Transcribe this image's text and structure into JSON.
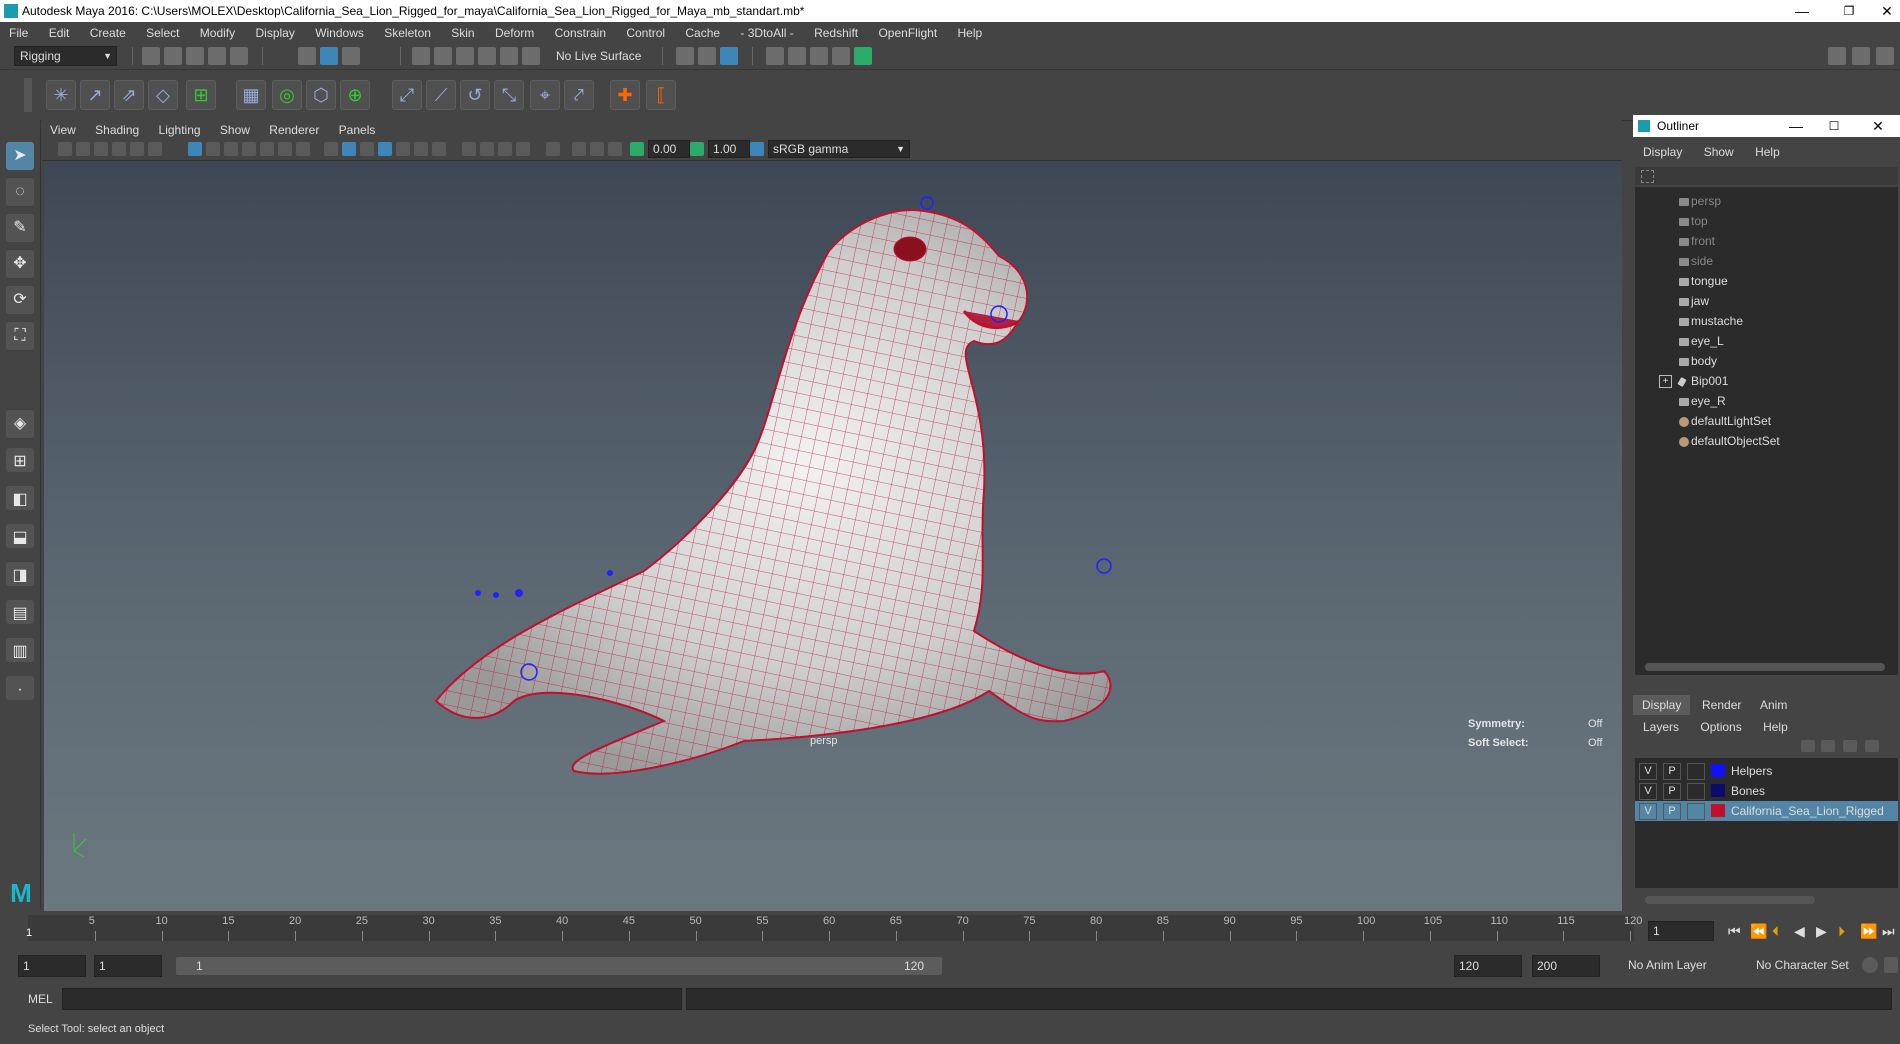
{
  "window": {
    "title": "Autodesk Maya 2016: C:\\Users\\MOLEX\\Desktop\\California_Sea_Lion_Rigged_for_maya\\California_Sea_Lion_Rigged_for_Maya_mb_standart.mb*",
    "minimize": "—",
    "restore": "❐",
    "close": "✕"
  },
  "menubar": [
    "File",
    "Edit",
    "Create",
    "Select",
    "Modify",
    "Display",
    "Windows",
    "Skeleton",
    "Skin",
    "Deform",
    "Constrain",
    "Control",
    "Cache",
    "- 3DtoAll -",
    "Redshift",
    "OpenFlight",
    "Help"
  ],
  "statusline": {
    "menu_set": "Rigging",
    "live_surface": "No Live Surface"
  },
  "viewport": {
    "menu": [
      "View",
      "Shading",
      "Lighting",
      "Show",
      "Renderer",
      "Panels"
    ],
    "exposure": "0.00",
    "gamma": "1.00",
    "color_space": "sRGB gamma",
    "camera_label": "persp",
    "symmetry_label": "Symmetry:",
    "symmetry_value": "Off",
    "soft_select_label": "Soft Select:",
    "soft_select_value": "Off"
  },
  "outliner": {
    "title": "Outliner",
    "menu": [
      "Display",
      "Show",
      "Help"
    ],
    "items": [
      {
        "label": "persp",
        "dim": true
      },
      {
        "label": "top",
        "dim": true
      },
      {
        "label": "front",
        "dim": true
      },
      {
        "label": "side",
        "dim": true
      },
      {
        "label": "tongue",
        "dim": false
      },
      {
        "label": "jaw",
        "dim": false
      },
      {
        "label": "mustache",
        "dim": false
      },
      {
        "label": "eye_L",
        "dim": false
      },
      {
        "label": "body",
        "dim": false
      },
      {
        "label": "Bip001",
        "dim": false
      },
      {
        "label": "eye_R",
        "dim": false
      },
      {
        "label": "defaultLightSet",
        "dim": false
      },
      {
        "label": "defaultObjectSet",
        "dim": false
      }
    ]
  },
  "layer_editor": {
    "tabs": [
      "Display",
      "Render",
      "Anim"
    ],
    "menu": [
      "Layers",
      "Options",
      "Help"
    ],
    "layers": [
      {
        "v": "V",
        "p": "P",
        "name": "Helpers",
        "color": "#1010ff"
      },
      {
        "v": "V",
        "p": "P",
        "name": "Bones",
        "color": "#0b0b6b"
      },
      {
        "v": "V",
        "p": "P",
        "name": "California_Sea_Lion_Rigged",
        "color": "#c0102e"
      }
    ]
  },
  "timeline": {
    "ticks": [
      "5",
      "10",
      "15",
      "20",
      "25",
      "30",
      "35",
      "40",
      "45",
      "50",
      "55",
      "60",
      "65",
      "70",
      "75",
      "80",
      "85",
      "90",
      "95",
      "100",
      "105",
      "110",
      "115",
      "120"
    ],
    "current_frame_marker": "1",
    "current_frame": "1"
  },
  "range": {
    "start": "1",
    "playback_start": "1",
    "slider_start": "1",
    "slider_end": "120",
    "playback_end": "120",
    "end": "200",
    "anim_layer": "No Anim Layer",
    "character_set": "No Character Set"
  },
  "command": {
    "label": "MEL"
  },
  "help": {
    "text": "Select Tool: select an object"
  },
  "colors": {
    "wire": "#c0102e",
    "select": "#5285a6",
    "accent": "#2bab6a"
  }
}
